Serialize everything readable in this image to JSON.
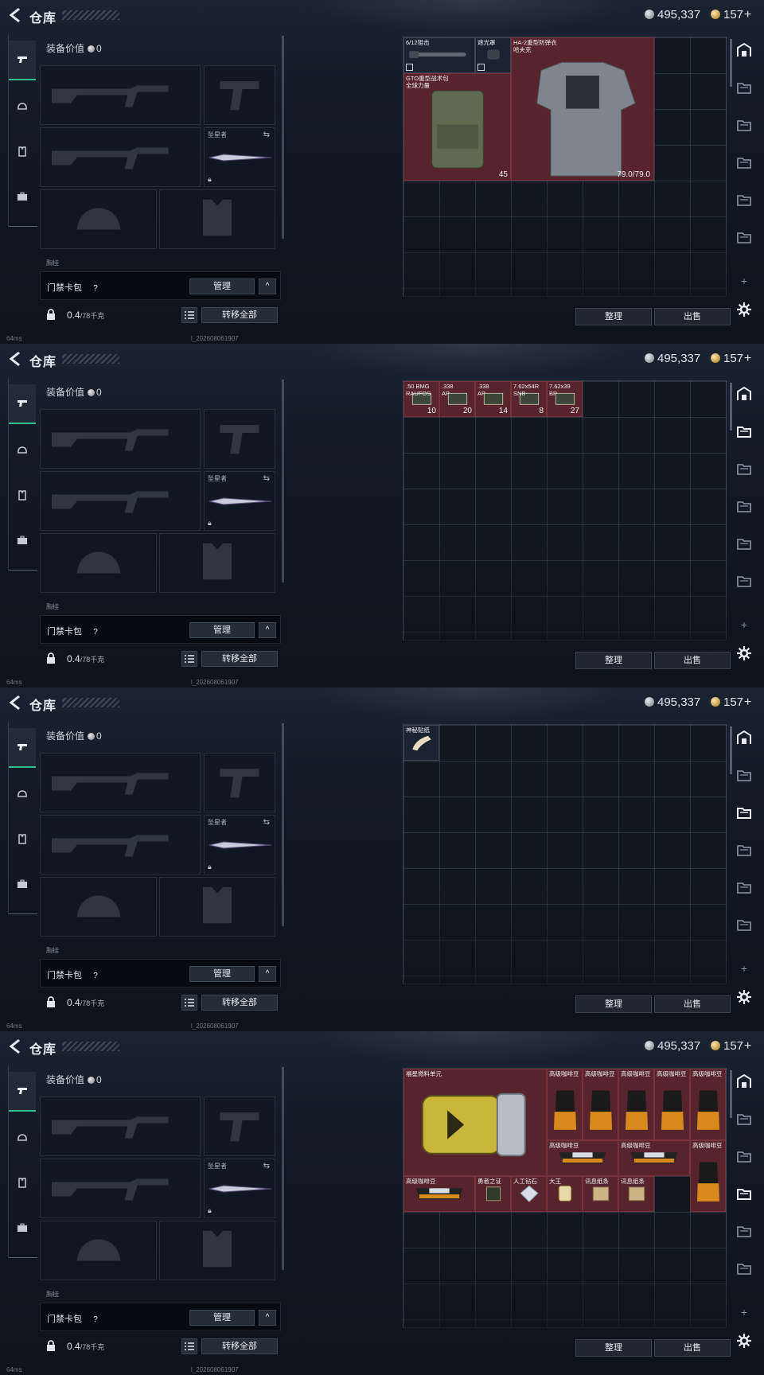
{
  "title": "仓库",
  "currency": {
    "silver": "495,337",
    "gold": "157",
    "gold_plus": "+"
  },
  "equipment": {
    "value_label": "装备价值",
    "value": "0",
    "knife_name": "坠星者",
    "partial_label": "胸挂",
    "card_pack_label": "门禁卡包",
    "help": "?",
    "manage_button": "管理",
    "collapse_button": "^",
    "weight": "0.4",
    "weight_max": "/78千克",
    "transfer_button": "转移全部"
  },
  "storage": {
    "sort_button": "整理",
    "sell_button": "出售"
  },
  "status": {
    "ping": "64ms",
    "build": "l_202608061907"
  },
  "panels": [
    {
      "active_rail": 0,
      "items": [
        {
          "name": "6/12狙击",
          "style": "dark",
          "pic": "scope",
          "corner": true
        },
        {
          "name": "遮光罩",
          "style": "dark",
          "pic": "hood",
          "corner": true
        },
        {
          "name": "HA-2重型防弹衣\n哈夫克",
          "pic": "armor",
          "durability": "79.0/79.0"
        },
        {
          "name": "GTO重型战术包\n全球力量",
          "pic": "backpack",
          "quantity": "45"
        }
      ]
    },
    {
      "active_rail": 1,
      "items": [
        {
          "name": ".50 BMG\nRAUFOS",
          "pic": "ammo",
          "quantity": "10"
        },
        {
          "name": ".338\nAP",
          "pic": "ammo",
          "quantity": "20"
        },
        {
          "name": ".338\nAP",
          "pic": "ammo",
          "quantity": "14"
        },
        {
          "name": "7.62x54R\nSNB",
          "pic": "ammo",
          "quantity": "8"
        },
        {
          "name": "7.62x39\nBP",
          "pic": "ammo",
          "quantity": "27"
        }
      ]
    },
    {
      "active_rail": 2,
      "items": [
        {
          "name": "神秘贴纸",
          "style": "dark",
          "pic": "tape"
        }
      ]
    },
    {
      "active_rail": 3,
      "items": [
        {
          "name": "福星燃料单元",
          "pic": "fuel"
        },
        {
          "name": "高级咖啡豆",
          "pic": "coffee"
        },
        {
          "name": "高级咖啡豆",
          "pic": "coffee"
        },
        {
          "name": "高级咖啡豆",
          "pic": "coffee"
        },
        {
          "name": "高级咖啡豆",
          "pic": "coffee"
        },
        {
          "name": "高级咖啡豆",
          "pic": "coffee"
        },
        {
          "name": "高级咖啡豆",
          "pic": "coffee-bag"
        },
        {
          "name": "高级咖啡豆",
          "pic": "coffee-bag"
        },
        {
          "name": "高级咖啡豆",
          "pic": "coffee"
        },
        {
          "name": "高级咖啡豆",
          "pic": "coffee-bag"
        },
        {
          "name": "勇者之证",
          "pic": "badge"
        },
        {
          "name": "人工钻石",
          "pic": "diamond"
        },
        {
          "name": "大王",
          "pic": "card"
        },
        {
          "name": "讯息纸条",
          "pic": "note"
        },
        {
          "name": "讯息纸条",
          "pic": "note"
        }
      ]
    }
  ],
  "icons": {
    "back": "back-arrow-icon",
    "left_tabs": [
      "gun-icon",
      "helmet-icon",
      "vest-icon",
      "briefcase-icon"
    ],
    "right_rail": [
      "storage-icon",
      "folder-icon",
      "folder-icon",
      "folder-icon",
      "folder-icon",
      "folder-icon",
      "add-icon",
      "gear-icon"
    ]
  },
  "colors": {
    "accent": "#2ec08c",
    "item_red": "#57232c",
    "grid_bg": "#12181f"
  }
}
